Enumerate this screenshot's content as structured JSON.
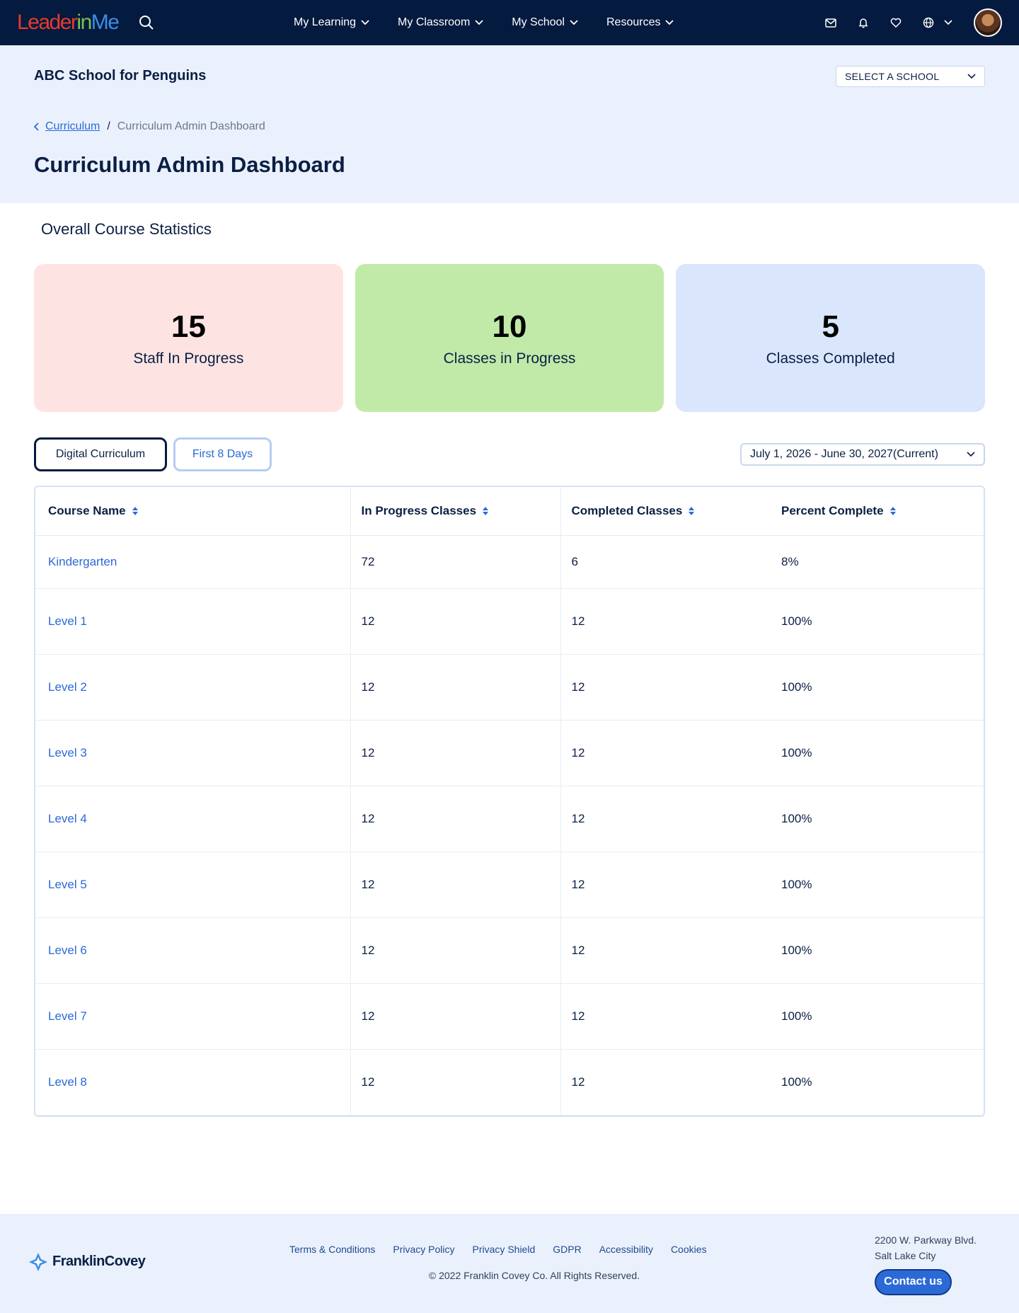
{
  "brand": {
    "logo_part1": "Leader",
    "logo_part2": "in",
    "logo_part3": "Me"
  },
  "nav": {
    "items": [
      {
        "label": "My Learning"
      },
      {
        "label": "My Classroom"
      },
      {
        "label": "My School"
      },
      {
        "label": "Resources"
      }
    ]
  },
  "header": {
    "school_name": "ABC School for Penguins",
    "school_select": "SELECT A SCHOOL",
    "breadcrumb_link": "Curriculum",
    "breadcrumb_sep": "/",
    "breadcrumb_current": "Curriculum Admin Dashboard",
    "page_title": "Curriculum Admin Dashboard"
  },
  "stats": {
    "title": "Overall Course Statistics",
    "cards": [
      {
        "value": "15",
        "label": "Staff In Progress",
        "color": "#fde4e2"
      },
      {
        "value": "10",
        "label": "Classes in Progress",
        "color": "#c1eaa8"
      },
      {
        "value": "5",
        "label": "Classes Completed",
        "color": "#d9e6fc"
      }
    ]
  },
  "filters": {
    "tab_active": "Digital Curriculum",
    "tab_inactive": "First 8 Days",
    "year": "July 1, 2026 - June 30, 2027(Current)"
  },
  "table": {
    "headers": [
      "Course Name",
      "In Progress Classes",
      "Completed Classes",
      "Percent Complete"
    ],
    "rows": [
      {
        "name": "Kindergarten",
        "in_progress": "72",
        "completed": "6",
        "percent": "8%"
      },
      {
        "name": "Level 1",
        "in_progress": "12",
        "completed": "12",
        "percent": "100%"
      },
      {
        "name": "Level 2",
        "in_progress": "12",
        "completed": "12",
        "percent": "100%"
      },
      {
        "name": "Level 3",
        "in_progress": "12",
        "completed": "12",
        "percent": "100%"
      },
      {
        "name": "Level 4",
        "in_progress": "12",
        "completed": "12",
        "percent": "100%"
      },
      {
        "name": "Level 5",
        "in_progress": "12",
        "completed": "12",
        "percent": "100%"
      },
      {
        "name": "Level 6",
        "in_progress": "12",
        "completed": "12",
        "percent": "100%"
      },
      {
        "name": "Level 7",
        "in_progress": "12",
        "completed": "12",
        "percent": "100%"
      },
      {
        "name": "Level 8",
        "in_progress": "12",
        "completed": "12",
        "percent": "100%"
      }
    ]
  },
  "footer": {
    "logo_text": "FranklinCovey",
    "links": [
      "Terms & Conditions",
      "Privacy Policy",
      "Privacy Shield",
      "GDPR",
      "Accessibility",
      "Cookies"
    ],
    "copyright": "© 2022 Franklin Covey Co. All Rights Reserved.",
    "address_line1": "2200 W. Parkway Blvd.",
    "address_line2": "Salt Lake City",
    "contact_label": "Contact us"
  },
  "colors": {
    "nav_bg": "#051a3f",
    "accent": "#2b6ad6",
    "header_bg": "#eaf1fd"
  }
}
